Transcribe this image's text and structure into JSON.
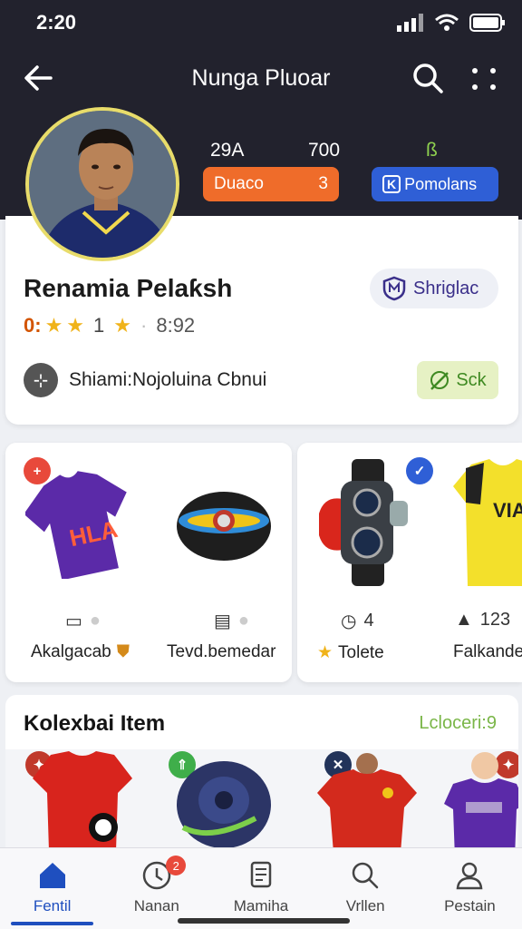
{
  "status_bar": {
    "time": "2:20"
  },
  "header": {
    "title": "Nunga Pluoar",
    "stats": [
      "29A",
      "700",
      "ß"
    ],
    "primary_button": {
      "label": "Duaco",
      "suffix": "3"
    },
    "secondary_button": {
      "label": "Pomolans",
      "icon_text": "K"
    }
  },
  "profile": {
    "name": "Renamia Pelaƙsh",
    "badge": {
      "label": "Shriglac"
    },
    "rating": {
      "prefix": "0:",
      "star_count_text": "1",
      "value": "8:92"
    },
    "location": "Shiami:Nojoluina Cbnui",
    "action_label": "Sck"
  },
  "items": [
    {
      "meta": "",
      "label": "Akalgacab",
      "badge": "orange"
    },
    {
      "meta": "",
      "label": "Tevd.bemedar",
      "badge": "none"
    },
    {
      "meta": "4",
      "label": "Tolete",
      "badge": "blue"
    },
    {
      "meta": "123",
      "label": "Falkande",
      "badge": "none"
    }
  ],
  "collection": {
    "title": "Kolexbai Item",
    "link": "Lcloceri:9"
  },
  "bottom_nav": [
    {
      "label": "Fentil",
      "icon": "home-icon",
      "active": true
    },
    {
      "label": "Nanan",
      "icon": "clock-icon",
      "badge": "2"
    },
    {
      "label": "Mamiha",
      "icon": "scroll-icon"
    },
    {
      "label": "Vrllen",
      "icon": "search-icon"
    },
    {
      "label": "Pestain",
      "icon": "user-icon"
    }
  ],
  "colors": {
    "header_bg": "#22222d",
    "orange": "#ef6c2a",
    "blue": "#2f5fd6",
    "accent_green": "#7ab648",
    "nav_active": "#1f4fbf"
  }
}
